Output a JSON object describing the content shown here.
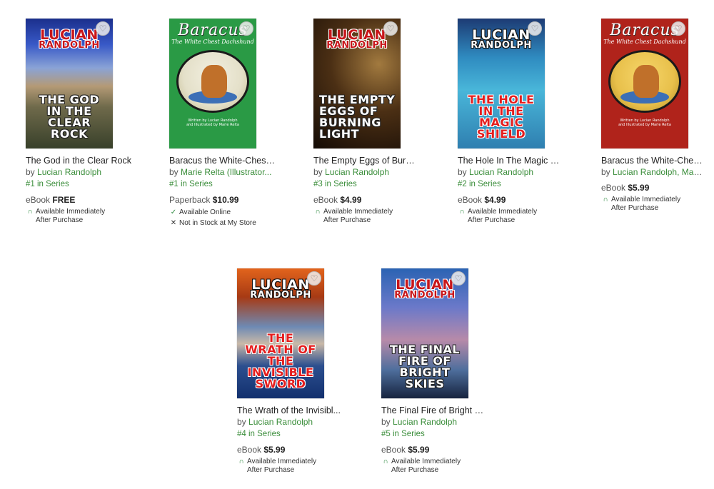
{
  "colors": {
    "link_green": "#3a8d3a",
    "baracus_green": "#2a9a45",
    "baracus_red": "#b0231b"
  },
  "heart_icon": "♡",
  "books": [
    {
      "cover": {
        "author_line1": "Lucian",
        "author_line2": "Randolph",
        "title_text": "The God in the Clear Rock"
      },
      "title": "The God in the Clear Rock",
      "by": "by",
      "authors": "Lucian Randolph",
      "series": "#1 in Series",
      "format": "eBook",
      "price": "FREE",
      "availability": [
        {
          "icon": "available-arc-icon",
          "line1": "Available Immediately",
          "line2": "After Purchase"
        }
      ]
    },
    {
      "cover": {
        "title_text": "Baracus",
        "subtitle": "The White Chest Dachshund",
        "credit_1": "Written by Lucian Randolph",
        "credit_2": "and Illustrated by Marie Relta"
      },
      "title": "Baracus the White-Chest...",
      "by": "by",
      "authors": "Marie Relta (Illustrator...",
      "series": "#1 in Series",
      "format": "Paperback",
      "price": "$10.99",
      "availability": [
        {
          "icon": "check-icon",
          "line1": "Available Online"
        },
        {
          "icon": "x-icon",
          "line1": "Not in Stock at My Store"
        }
      ]
    },
    {
      "cover": {
        "author_line1": "Lucian",
        "author_line2": "Randolph",
        "title_text": "The Empty Eggs of Burning Light"
      },
      "title": "The Empty Eggs of Burni...",
      "by": "by",
      "authors": "Lucian Randolph",
      "series": "#3 in Series",
      "format": "eBook",
      "price": "$4.99",
      "availability": [
        {
          "icon": "available-arc-icon",
          "line1": "Available Immediately",
          "line2": "After Purchase"
        }
      ]
    },
    {
      "cover": {
        "author_line1": "Lucian",
        "author_line2": "Randolph",
        "title_text": "The Hole in the Magic Shield"
      },
      "title": "The Hole In The Magic S...",
      "by": "by",
      "authors": "Lucian Randolph",
      "series": "#2 in Series",
      "format": "eBook",
      "price": "$4.99",
      "availability": [
        {
          "icon": "available-arc-icon",
          "line1": "Available Immediately",
          "line2": "After Purchase"
        }
      ]
    },
    {
      "cover": {
        "title_text": "Baracus",
        "subtitle": "The White Chest Dachshund",
        "credit_1": "Written by Lucian Randolph",
        "credit_2": "and Illustrated by Marie Relta"
      },
      "title": "Baracus the White-Chest...",
      "by": "by",
      "authors": "Lucian Randolph, Mari...",
      "series": "",
      "format": "eBook",
      "price": "$5.99",
      "availability": [
        {
          "icon": "available-arc-icon",
          "line1": "Available Immediately",
          "line2": "After Purchase"
        }
      ]
    },
    {
      "cover": {
        "author_line1": "Lucian",
        "author_line2": "Randolph",
        "title_text": "The Wrath of the Invisible Sword"
      },
      "title": "The Wrath of the Invisibl...",
      "by": "by",
      "authors": "Lucian Randolph",
      "series": "#4 in Series",
      "format": "eBook",
      "price": "$5.99",
      "availability": [
        {
          "icon": "available-arc-icon",
          "line1": "Available Immediately",
          "line2": "After Purchase"
        }
      ]
    },
    {
      "cover": {
        "author_line1": "Lucian",
        "author_line2": "Randolph",
        "title_text": "The Final Fire of Bright Skies"
      },
      "title": "The Final Fire of Bright S...",
      "by": "by",
      "authors": "Lucian Randolph",
      "series": "#5 in Series",
      "format": "eBook",
      "price": "$5.99",
      "availability": [
        {
          "icon": "available-arc-icon",
          "line1": "Available Immediately",
          "line2": "After Purchase"
        }
      ]
    }
  ]
}
